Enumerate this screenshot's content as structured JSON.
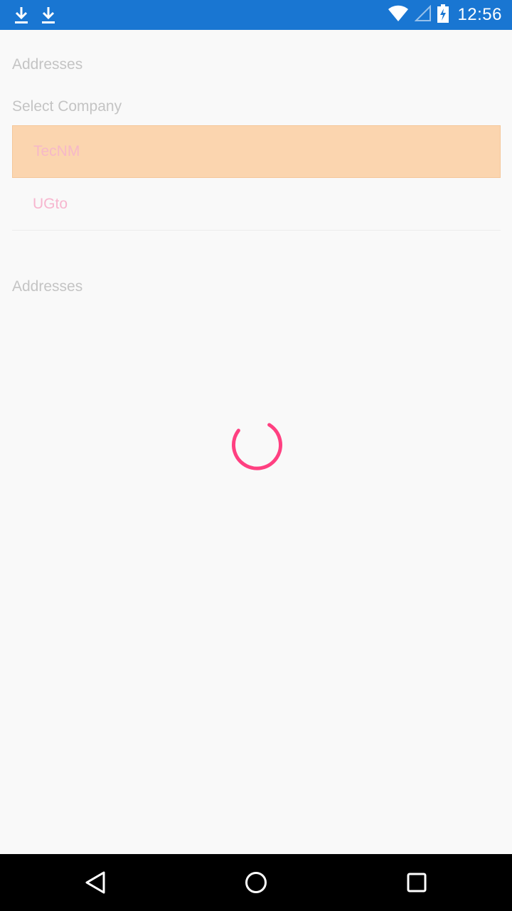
{
  "status_bar": {
    "time": "12:56",
    "left_icons": [
      "download-icon",
      "download-icon"
    ],
    "right_icons": [
      "wifi-icon",
      "signal-icon",
      "battery-charging-icon"
    ],
    "background_color": "#1976d2"
  },
  "page": {
    "header_label": "Addresses",
    "select_label": "Select Company",
    "companies": [
      {
        "label": "TecNM",
        "selected": true
      },
      {
        "label": "UGto",
        "selected": false
      }
    ],
    "addresses_label": "Addresses",
    "loading": true
  },
  "colors": {
    "accent": "#ff4081",
    "selected_background": "#fbd5af",
    "label_text": "#c4c4c4"
  },
  "nav_bar": {
    "buttons": [
      "back-icon",
      "home-icon",
      "recents-icon"
    ]
  }
}
